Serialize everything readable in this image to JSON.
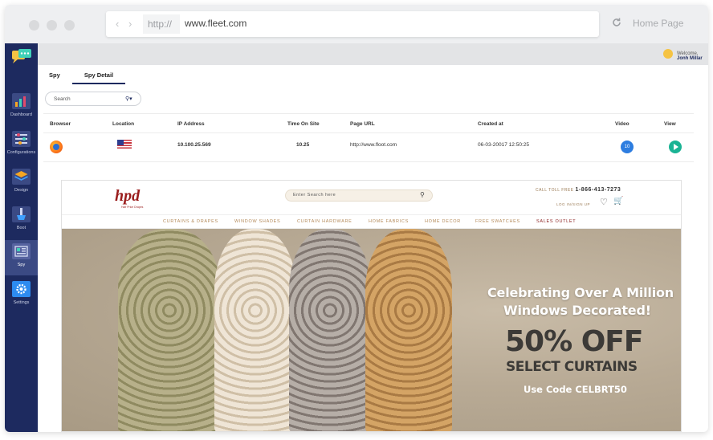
{
  "browser": {
    "url_protocol": "http://",
    "url": "www.fleet.com",
    "home_label": "Home Page"
  },
  "sidebar": {
    "items": [
      {
        "label": "Dashboard",
        "icon": "dashboard-icon",
        "color": "#f5a623"
      },
      {
        "label": "Configurations",
        "icon": "configurations-icon",
        "color": "#e24a6b"
      },
      {
        "label": "Design",
        "icon": "design-icon",
        "color": "#f5a623"
      },
      {
        "label": "Boot",
        "icon": "boot-icon",
        "color": "#3fa0ff"
      },
      {
        "label": "Spy",
        "icon": "spy-icon",
        "color": "#6b7bb8"
      },
      {
        "label": "Settings",
        "icon": "settings-icon",
        "color": "#2d8bf0"
      }
    ],
    "active": "Spy"
  },
  "topbar": {
    "welcome_prefix": "Welcome,",
    "user_name": "Jonh Millar"
  },
  "tabs": [
    {
      "label": "Spy"
    },
    {
      "label": "Spy Detail"
    }
  ],
  "search": {
    "placeholder": "Search"
  },
  "table": {
    "headers": [
      "Browser",
      "Location",
      "IP Address",
      "Time On Site",
      "Page URL",
      "Created at",
      "Video",
      "View"
    ],
    "rows": [
      {
        "browser": "firefox-icon",
        "location": "us-flag-icon",
        "ip": "10.100.25.569",
        "time_on_site": "10.25",
        "page_url": "http://www.floot.com",
        "created_at": "06-03-20017 12:50:25",
        "video": "10",
        "view": "play-icon"
      }
    ]
  },
  "preview": {
    "logo": "hpd",
    "logo_sub": "Half Price Drapes",
    "search_placeholder": "Enter Search here",
    "call_label": "CALL TOLL FREE",
    "phone": "1-866-413-7273",
    "login": "LOG IN/SIGN UP",
    "menu": [
      "CURTAINS & DRAPES",
      "WINDOW SHADES",
      "CURTAIN HARDWARE",
      "HOME FABRICS",
      "HOME DECOR",
      "FREE SWATCHES",
      "SALES OUTLET"
    ],
    "hero_line1": "Celebrating Over A Million",
    "hero_line2": "Windows Decorated!",
    "hero_offer": "50% OFF",
    "hero_select": "SELECT CURTAINS",
    "hero_code": "Use Code CELBRT50"
  }
}
